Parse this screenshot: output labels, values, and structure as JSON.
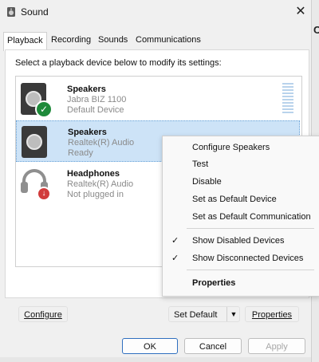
{
  "window": {
    "title": "Sound"
  },
  "tabs": [
    {
      "label": "Playback"
    },
    {
      "label": "Recording"
    },
    {
      "label": "Sounds"
    },
    {
      "label": "Communications"
    }
  ],
  "instruction": "Select a playback device below to modify its settings:",
  "devices": [
    {
      "name": "Speakers",
      "model": "Jabra BIZ 1100",
      "status": "Default Device"
    },
    {
      "name": "Speakers",
      "model": "Realtek(R) Audio",
      "status": "Ready"
    },
    {
      "name": "Headphones",
      "model": "Realtek(R) Audio",
      "status": "Not plugged in"
    }
  ],
  "context_menu": {
    "items": [
      {
        "label": "Configure Speakers"
      },
      {
        "label": "Test"
      },
      {
        "label": "Disable"
      },
      {
        "label": "Set as Default Device"
      },
      {
        "label": "Set as Default Communication"
      },
      {
        "label": "Show Disabled Devices",
        "checked": true
      },
      {
        "label": "Show Disconnected Devices",
        "checked": true
      },
      {
        "label": "Properties"
      }
    ]
  },
  "panel_buttons": {
    "configure": "Configure",
    "set_default": "Set Default",
    "properties": "Properties"
  },
  "dialog_buttons": {
    "ok": "OK",
    "cancel": "Cancel",
    "apply": "Apply"
  },
  "icons": {
    "title": "speaker-icon",
    "close": "close-icon",
    "default_badge": "checkmark-badge-icon",
    "unplugged_badge": "down-arrow-badge-icon"
  },
  "colors": {
    "selection": "#cde3f7",
    "ok_badge": "#1e8a3a",
    "unplugged_badge": "#d13b3b",
    "primary_border": "#2f6fbf"
  }
}
